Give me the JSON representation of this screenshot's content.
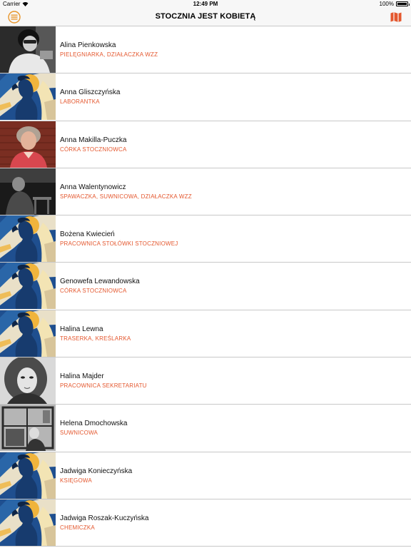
{
  "status_bar": {
    "carrier": "Carrier",
    "time": "12:49 PM",
    "battery": "100%",
    "battery_level": 1.0
  },
  "nav": {
    "title": "STOCZNIA JEST KOBIETĄ",
    "menu_icon": "hamburger-menu-icon",
    "map_icon": "map-icon"
  },
  "colors": {
    "accent": "#e4572e",
    "poster_blue": "#1f4f8f",
    "poster_yellow": "#f0b43c",
    "separator": "#c8c8c8"
  },
  "women": [
    {
      "name": "Alina Pienkowska",
      "role": "PIELĘGNIARKA, DZIAŁACZKA WZZ",
      "thumb": "photo-bw"
    },
    {
      "name": "Anna Gliszczyńska",
      "role": "LABORANTKA",
      "thumb": "poster"
    },
    {
      "name": "Anna Makilla-Puczka",
      "role": "CÓRKA STOCZNIOWCA",
      "thumb": "photo-color"
    },
    {
      "name": "Anna Walentynowicz",
      "role": "SPAWACZKA, SUWNICOWA, DZIAŁACZKA WZZ",
      "thumb": "photo-bw-dark"
    },
    {
      "name": "Bożena Kwiecień",
      "role": "PRACOWNICA STOŁÓWKI STOCZNIOWEJ",
      "thumb": "poster"
    },
    {
      "name": "Genowefa Lewandowska",
      "role": "CÓRKA STOCZNIOWCA",
      "thumb": "poster"
    },
    {
      "name": "Halina Lewna",
      "role": "TRASERKA, KREŚLARKA",
      "thumb": "poster"
    },
    {
      "name": "Halina Majder",
      "role": "PRACOWNICA SEKRETARIATU",
      "thumb": "photo-bw-portrait"
    },
    {
      "name": "Helena Dmochowska",
      "role": "SUWNICOWA",
      "thumb": "photo-bw-crane"
    },
    {
      "name": "Jadwiga Konieczyńska",
      "role": "KSIĘGOWA",
      "thumb": "poster"
    },
    {
      "name": "Jadwiga Roszak-Kuczyńska",
      "role": "CHEMICZKA",
      "thumb": "poster"
    }
  ]
}
